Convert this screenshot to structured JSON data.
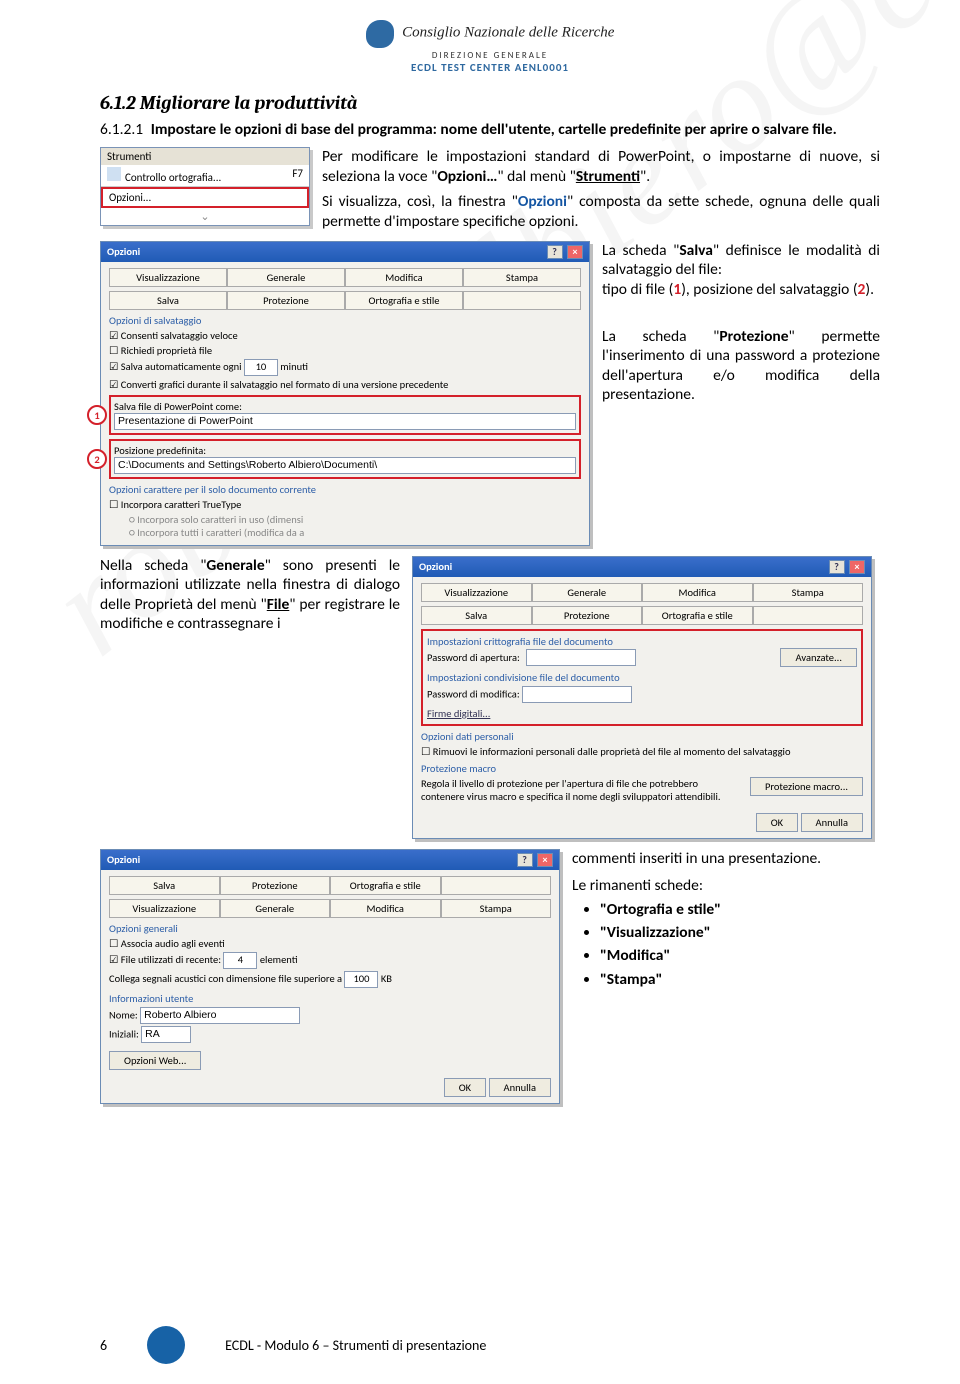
{
  "header": {
    "cnr": "Consiglio Nazionale delle Ricerche",
    "dir": "DIREZIONE GENERALE",
    "center": "ECDL TEST CENTER AENL0001"
  },
  "section_title": "6.1.2  Migliorare la produttività",
  "subhead_num": "6.1.2.1",
  "subhead_text": "Impostare le opzioni di base del programma: nome dell'utente, cartelle predefinite per aprire o salvare file.",
  "para1a": "Per modificare le impostazioni standard di PowerPoint, o impostarne di nuove, si seleziona la voce \"",
  "opzioni_elips": "Opzioni…",
  "para1b": "\" dal menù \"",
  "strumenti": "Strumenti",
  "para1c": "\".",
  "para2a": "Si visualizza, così, la finestra \"",
  "opzioni_lbl": "Opzioni",
  "para2b": "\" composta da sette schede, ognuna delle quali permette d'impostare specifiche opzioni.",
  "para3a": "La scheda \"",
  "salva_lbl": "Salva",
  "para3b": "\" definisce le modalità di salvataggio del file:",
  "para3c": "tipo di file (",
  "one": "1",
  "para3d": "), posizione del salvataggio (",
  "two": "2",
  "para3e": ").",
  "para4a": "La scheda \"",
  "protez_lbl": "Protezione",
  "para4b": "\" permette l'inserimento di una password a protezione dell'apertura e/o modifica della presentazione.",
  "para5a": "Nella scheda \"",
  "generale_lbl": "Generale",
  "para5b_pre": "\" sono presenti le informazioni utilizzate nella finestra di dialogo delle Proprietà del menù \"",
  "file_lbl": "File",
  "para5b_post": "\" per registrare le modifiche e contrassegnare i",
  "para6": "commenti inseriti in una presentazione.",
  "para7": "Le rimanenti schede:",
  "bullets": [
    "\"Ortografia e stile\"",
    "\"Visualizzazione\"",
    "\"Modifica\"",
    "\"Stampa\""
  ],
  "menu": {
    "head": "Strumenti",
    "item1": "Controllo ortografia...",
    "item1_key": "F7",
    "item_hi": "Opzioni..."
  },
  "dlg_salva": {
    "title": "Opzioni",
    "tabs_top": [
      "Visualizzazione",
      "Generale",
      "Modifica",
      "Stampa"
    ],
    "tabs_bot": [
      "Salva",
      "Protezione",
      "Ortografia e stile",
      ""
    ],
    "grp1": "Opzioni di salvataggio",
    "cb1": "Consenti salvataggio veloce",
    "cb2": "Richiedi proprietà file",
    "cb3a": "Salva automaticamente ogni",
    "cb3_spin": "10",
    "cb3b": "minuti",
    "cb4": "Converti grafici durante il salvataggio nel formato di una versione precedente",
    "lbl1": "Salva file di PowerPoint come:",
    "val1": "Presentazione di PowerPoint",
    "lbl2": "Posizione predefinita:",
    "val2": "C:\\Documents and Settings\\Roberto Albiero\\Documenti\\",
    "grp2": "Opzioni carattere per il solo documento corrente",
    "cb5": "Incorpora caratteri TrueType",
    "r1": "Incorpora solo caratteri in uso (dimensi",
    "r2": "Incorpora tutti i caratteri (modifica da a"
  },
  "dlg_prot": {
    "title": "Opzioni",
    "tabs_top": [
      "Visualizzazione",
      "Generale",
      "Modifica",
      "Stampa"
    ],
    "tabs_bot": [
      "Salva",
      "Protezione",
      "Ortografia e stile",
      ""
    ],
    "grp1": "Impostazioni crittografia file del documento",
    "lbl1": "Password di apertura:",
    "btn_adv": "Avanzate...",
    "grp2": "Impostazioni condivisione file del documento",
    "lbl2": "Password di modifica:",
    "link": "Firme digitali...",
    "grp3": "Opzioni dati personali",
    "cb1": "Rimuovi le informazioni personali dalle proprietà del file al momento del salvataggio",
    "grp4": "Protezione macro",
    "note": "Regola il livello di protezione per l'apertura di file che potrebbero contenere virus macro e specifica il nome degli sviluppatori attendibili.",
    "btn_macro": "Protezione macro...",
    "ok": "OK",
    "cancel": "Annulla"
  },
  "dlg_gen": {
    "title": "Opzioni",
    "tabs_top": [
      "Salva",
      "Protezione",
      "Ortografia e stile",
      ""
    ],
    "tabs_bot": [
      "Visualizzazione",
      "Generale",
      "Modifica",
      "Stampa"
    ],
    "grp1": "Opzioni generali",
    "cb1": "Associa audio agli eventi",
    "cb2": "File utilizzati di recente:",
    "spin2": "4",
    "cb2b": "elementi",
    "cb3a": "Collega segnali acustici con dimensione file superiore a",
    "spin3": "100",
    "cb3b": "KB",
    "grp2": "Informazioni utente",
    "lbl_name": "Nome:",
    "val_name": "Roberto Albiero",
    "lbl_init": "Iniziali:",
    "val_init": "RA",
    "btn_web": "Opzioni Web...",
    "ok": "OK",
    "cancel": "Annulla"
  },
  "footer": {
    "page": "6",
    "text": "ECDL - Modulo 6 – Strumenti di presentazione"
  }
}
